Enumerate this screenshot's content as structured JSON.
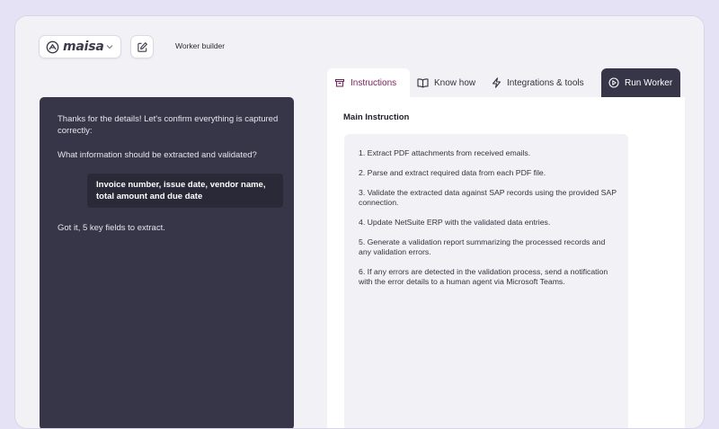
{
  "header": {
    "logo_text": "maisa",
    "page_title": "Worker builder"
  },
  "chat": {
    "messages": [
      {
        "role": "agent",
        "text": "Thanks for the details! Let's confirm everything is captured correctly:"
      },
      {
        "role": "agent",
        "text": "What information should be extracted and validated?"
      },
      {
        "role": "user",
        "text": "Invoice number, issue date, vendor name, total amount and due date"
      },
      {
        "role": "agent",
        "text": "Got it, 5 key fields to extract."
      }
    ]
  },
  "tabs": [
    {
      "label": "Instructions",
      "icon": "instructions-icon",
      "active": true
    },
    {
      "label": "Know how",
      "icon": "book-icon",
      "active": false
    },
    {
      "label": "Integrations & tools",
      "icon": "lightning-icon",
      "active": false
    },
    {
      "label": "Run Worker",
      "icon": "play-circle-icon",
      "active": false
    }
  ],
  "main": {
    "heading": "Main Instruction",
    "instructions": [
      "1. Extract PDF attachments from received emails.",
      "2. Parse and extract required data from each PDF file.",
      "3. Validate the extracted data against SAP records using the provided SAP connection.",
      "4. Update NetSuite ERP with the validated data entries.",
      "5. Generate a validation report summarizing the processed records and any validation errors.",
      "6. If any errors are detected in the validation process, send a notification with the error details to a human agent via Microsoft Teams."
    ]
  },
  "colors": {
    "accent": "#7a1e5c",
    "dark_panel": "#373548",
    "background": "#e4e2f4"
  }
}
